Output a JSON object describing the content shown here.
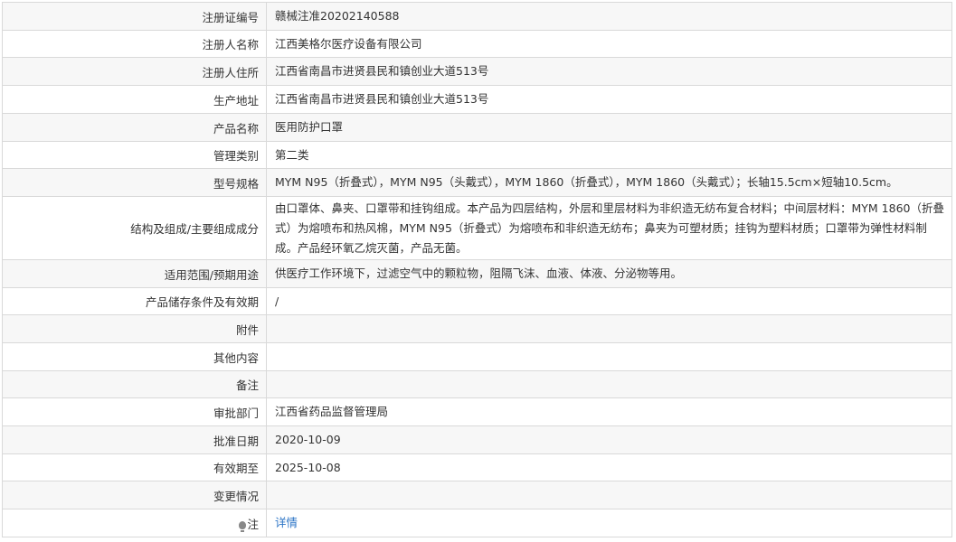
{
  "rows": [
    {
      "label": "注册证编号",
      "value": "赣械注准20202140588"
    },
    {
      "label": "注册人名称",
      "value": "江西美格尔医疗设备有限公司"
    },
    {
      "label": "注册人住所",
      "value": "江西省南昌市进贤县民和镇创业大道513号"
    },
    {
      "label": "生产地址",
      "value": "江西省南昌市进贤县民和镇创业大道513号"
    },
    {
      "label": "产品名称",
      "value": "医用防护口罩"
    },
    {
      "label": "管理类别",
      "value": "第二类"
    },
    {
      "label": "型号规格",
      "value": "MYM N95（折叠式），MYM N95（头戴式），MYM 1860（折叠式），MYM 1860（头戴式）；长轴15.5cm×短轴10.5cm。"
    },
    {
      "label": "结构及组成/主要组成成分",
      "value": "由口罩体、鼻夹、口罩带和挂钩组成。本产品为四层结构，外层和里层材料为非织造无纺布复合材料；中间层材料：MYM 1860（折叠式）为熔喷布和热风棉，MYM N95（折叠式）为熔喷布和非织造无纺布；鼻夹为可塑材质；挂钩为塑料材质；口罩带为弹性材料制成。产品经环氧乙烷灭菌，产品无菌。"
    },
    {
      "label": "适用范围/预期用途",
      "value": "供医疗工作环境下，过滤空气中的颗粒物，阻隔飞沫、血液、体液、分泌物等用。"
    },
    {
      "label": "产品储存条件及有效期",
      "value": "/"
    },
    {
      "label": "附件",
      "value": ""
    },
    {
      "label": "其他内容",
      "value": ""
    },
    {
      "label": "备注",
      "value": ""
    },
    {
      "label": "审批部门",
      "value": "江西省药品监督管理局"
    },
    {
      "label": "批准日期",
      "value": "2020-10-09"
    },
    {
      "label": "有效期至",
      "value": "2025-10-08"
    },
    {
      "label": "变更情况",
      "value": ""
    }
  ],
  "note": {
    "icon": "lightbulb-icon",
    "label": "注",
    "link_text": "详情",
    "link_color": "#2a73c5"
  }
}
